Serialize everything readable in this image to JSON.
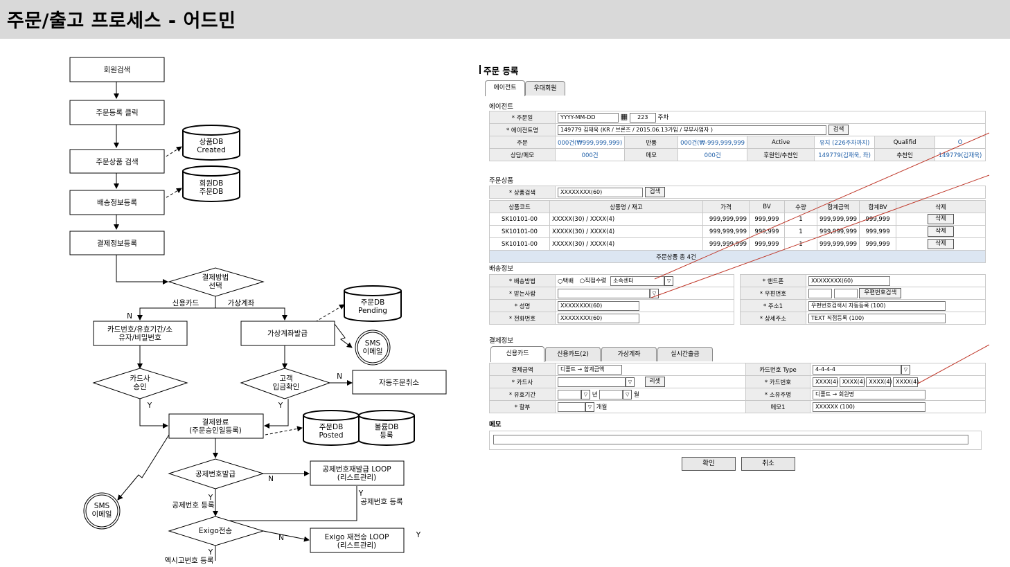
{
  "page": {
    "title": "주문/출고 프로세스 - 어드민"
  },
  "flow": {
    "nodes": {
      "member_search": "회원검색",
      "order_click": "주문등록 클릭",
      "product_search": "주문상품 검색",
      "product_db": [
        "상품DB",
        "Created"
      ],
      "member_db": [
        "회원DB",
        "주문DB"
      ],
      "delivery": "배송정보등록",
      "payment_info": "결제정보등록",
      "payment_method": [
        "결제방법",
        "선택"
      ],
      "credit_card": "신용카드",
      "virtual_account": "가상계좌",
      "card_info": [
        "카드번호/유효기간/소",
        "유자/비밀번호"
      ],
      "va_issue": "가상계좌발급",
      "order_pending_db": [
        "주문DB",
        "Pending"
      ],
      "sms1": [
        "SMS",
        "이메일"
      ],
      "card_approve": [
        "카드사",
        "승인"
      ],
      "deposit_check": [
        "고객",
        "입금확인"
      ],
      "auto_cancel": "자동주문취소",
      "pay_complete": [
        "결제완료",
        "(주문승인일등록)"
      ],
      "order_posted_db": [
        "주문DB",
        "Posted"
      ],
      "volume_db": [
        "볼륨DB",
        "등록"
      ],
      "sms2": [
        "SMS",
        "이메일"
      ],
      "deduct_issue": "공제번호발급",
      "deduct_loop": [
        "공제번호재발급 LOOP",
        "(리스트관리)"
      ],
      "exigo_send": "Exigo전송",
      "exigo_loop": [
        "Exigo 재전송 LOOP",
        "(리스트관리)"
      ],
      "deduct_reg1": "공제번호 등록",
      "deduct_reg2": "공제번호 등록",
      "exigo_reg": "엑시고번호 등록",
      "n": "N",
      "y": "Y"
    }
  },
  "form": {
    "title": "주문 등록",
    "tabs": [
      "에이전트",
      "우대회원"
    ],
    "agent": {
      "section": "에이전트",
      "order_date_label": "* 주문일",
      "order_date_value": "YYYY-MM-DD",
      "week_value": "223",
      "week_unit": "주차",
      "agent_name_label": "* 에이전트명",
      "agent_name_value": "149779 김재욱 (KR / 브론즈 / 2015.06.13가입 / 부부사업자 )",
      "search_btn": "검색",
      "row3": [
        "주문",
        "000건(₩999,999,999)",
        "반품",
        "000건(₩-999,999,999",
        "Active",
        "유지 (226주차까지)",
        "Qualifid",
        "O"
      ],
      "row4": [
        "상담/메모",
        "000건",
        "메모",
        "000건",
        "후원인/추천인",
        "149779(김재욱, 좌)",
        "추천인",
        "149779(김재욱)"
      ]
    },
    "products": {
      "section": "주문상품",
      "search_label": "* 상품검색",
      "search_value": "XXXXXXXX(60)",
      "search_btn": "검색",
      "headers": [
        "상품코드",
        "상품명 / 재고",
        "가격",
        "BV",
        "수량",
        "합계금액",
        "합계BV",
        "삭제"
      ],
      "rows": [
        [
          "SK10101-00",
          "XXXXX(30) / XXXX(4)",
          "999,999,999",
          "999,999",
          "1",
          "999,999,999",
          "999,999",
          "삭제"
        ],
        [
          "SK10101-00",
          "XXXXX(30) / XXXX(4)",
          "999,999,999",
          "999,999",
          "1",
          "999,999,999",
          "999,999",
          "삭제"
        ],
        [
          "SK10101-00",
          "XXXXX(30) / XXXX(4)",
          "999,999,999",
          "999,999",
          "1",
          "999,999,999",
          "999,999",
          "삭제"
        ]
      ],
      "total": "주문상품 총 4건"
    },
    "delivery": {
      "section": "배송정보",
      "method_label": "* 배송방법",
      "opt1": "○택배",
      "opt2": "○직접수령",
      "center": "소속센터",
      "receiver_label": "* 받는사람",
      "name_label": "* 성명",
      "name_value": "XXXXXXXX(60)",
      "phone_label": "* 전화번호",
      "phone_value": "XXXXXXXX(60)",
      "mobile_label": "* 핸드폰",
      "mobile_value": "XXXXXXXX(60)",
      "zip_label": "* 우편번호",
      "zip_btn": "우편번호검색",
      "addr1_label": "* 주소1",
      "addr1_value": "우편번호검색시 자동등록 (100)",
      "addr2_label": "* 상세주소",
      "addr2_value": "TEXT 직접등록 (100)"
    },
    "payment": {
      "section": "결제정보",
      "tabs": [
        "신용카드",
        "신용카드(2)",
        "가상계좌",
        "실시간출금"
      ],
      "amount_label": "결제금액",
      "amount_value": "디폴트 → 합계금액",
      "card_company_label": "* 카드사",
      "reset_btn": "리셋",
      "expiry_label": "* 유효기간",
      "year": "년",
      "month": "월",
      "installment_label": "* 할부",
      "months": "개월",
      "card_type_label": "카드번호 Type",
      "card_type_value": "4-4-4-4",
      "card_no_label": "* 카드번호",
      "card_no_parts": [
        "XXXX(4)",
        "XXXX(4)",
        "XXXX(4)",
        "XXXX(4)"
      ],
      "owner_label": "* 소유주명",
      "owner_value": "디폴트 → 회원명",
      "memo1_label": "메모1",
      "memo1_value": "XXXXXX (100)"
    },
    "memo": {
      "section": "메모"
    },
    "confirm_btn": "확인",
    "cancel_btn": "취소"
  }
}
